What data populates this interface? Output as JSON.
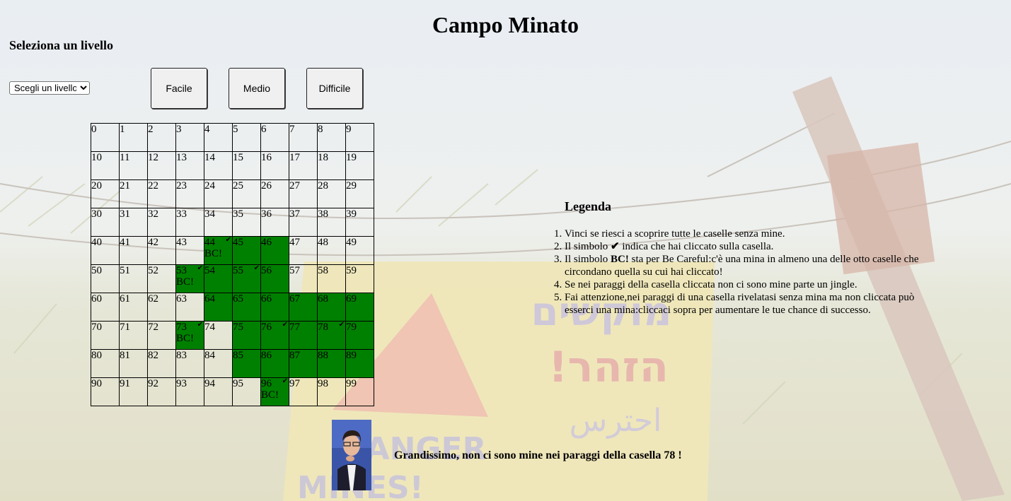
{
  "title": "Campo Minato",
  "level_section": {
    "title": "Seleziona un livello",
    "select_value": "Scegli un livello",
    "buttons": [
      "Facile",
      "Medio",
      "Difficile"
    ]
  },
  "grid": {
    "rows": 10,
    "cols": 10,
    "cells": [
      {
        "n": "0"
      },
      {
        "n": "1"
      },
      {
        "n": "2"
      },
      {
        "n": "3"
      },
      {
        "n": "4"
      },
      {
        "n": "5"
      },
      {
        "n": "6"
      },
      {
        "n": "7"
      },
      {
        "n": "8"
      },
      {
        "n": "9"
      },
      {
        "n": "10"
      },
      {
        "n": "11"
      },
      {
        "n": "12"
      },
      {
        "n": "13"
      },
      {
        "n": "14"
      },
      {
        "n": "15"
      },
      {
        "n": "16"
      },
      {
        "n": "17"
      },
      {
        "n": "18"
      },
      {
        "n": "19"
      },
      {
        "n": "20"
      },
      {
        "n": "21"
      },
      {
        "n": "22"
      },
      {
        "n": "23"
      },
      {
        "n": "24"
      },
      {
        "n": "25"
      },
      {
        "n": "26"
      },
      {
        "n": "27"
      },
      {
        "n": "28"
      },
      {
        "n": "29"
      },
      {
        "n": "30"
      },
      {
        "n": "31"
      },
      {
        "n": "32"
      },
      {
        "n": "33"
      },
      {
        "n": "34"
      },
      {
        "n": "35"
      },
      {
        "n": "36"
      },
      {
        "n": "37"
      },
      {
        "n": "38"
      },
      {
        "n": "39"
      },
      {
        "n": "40"
      },
      {
        "n": "41"
      },
      {
        "n": "42"
      },
      {
        "n": "43"
      },
      {
        "n": "44",
        "state": "revealed",
        "bc": true,
        "checked": true
      },
      {
        "n": "45",
        "state": "revealed"
      },
      {
        "n": "46",
        "state": "revealed"
      },
      {
        "n": "47"
      },
      {
        "n": "48"
      },
      {
        "n": "49"
      },
      {
        "n": "50"
      },
      {
        "n": "51"
      },
      {
        "n": "52"
      },
      {
        "n": "53",
        "state": "revealed",
        "bc": true,
        "checked": true
      },
      {
        "n": "54",
        "state": "revealed"
      },
      {
        "n": "55",
        "state": "revealed",
        "checked": true
      },
      {
        "n": "56",
        "state": "revealed"
      },
      {
        "n": "57"
      },
      {
        "n": "58"
      },
      {
        "n": "59"
      },
      {
        "n": "60"
      },
      {
        "n": "61"
      },
      {
        "n": "62"
      },
      {
        "n": "63"
      },
      {
        "n": "64",
        "state": "revealed"
      },
      {
        "n": "65",
        "state": "revealed"
      },
      {
        "n": "66",
        "state": "revealed"
      },
      {
        "n": "67",
        "state": "revealed"
      },
      {
        "n": "68",
        "state": "revealed"
      },
      {
        "n": "69",
        "state": "revealed"
      },
      {
        "n": "70"
      },
      {
        "n": "71"
      },
      {
        "n": "72"
      },
      {
        "n": "73",
        "state": "revealed",
        "bc": true,
        "checked": true
      },
      {
        "n": "74"
      },
      {
        "n": "75",
        "state": "revealed"
      },
      {
        "n": "76",
        "state": "revealed",
        "checked": true
      },
      {
        "n": "77",
        "state": "revealed"
      },
      {
        "n": "78",
        "state": "revealed",
        "checked": true
      },
      {
        "n": "79",
        "state": "revealed"
      },
      {
        "n": "80"
      },
      {
        "n": "81"
      },
      {
        "n": "82"
      },
      {
        "n": "83"
      },
      {
        "n": "84"
      },
      {
        "n": "85",
        "state": "revealed"
      },
      {
        "n": "86",
        "state": "revealed"
      },
      {
        "n": "87",
        "state": "revealed"
      },
      {
        "n": "88",
        "state": "revealed"
      },
      {
        "n": "89",
        "state": "revealed"
      },
      {
        "n": "90"
      },
      {
        "n": "91"
      },
      {
        "n": "92"
      },
      {
        "n": "93"
      },
      {
        "n": "94"
      },
      {
        "n": "95"
      },
      {
        "n": "96",
        "state": "revealed",
        "bc": true,
        "checked": true
      },
      {
        "n": "97"
      },
      {
        "n": "98"
      },
      {
        "n": "99"
      }
    ],
    "bc_label": "BC!",
    "check_symbol": "✔",
    "revealed_color": "#008000"
  },
  "legend": {
    "title": "Legenda",
    "items": [
      {
        "text": "Vinci se riesci a scoprire tutte le caselle senza mine."
      },
      {
        "pre": "Il simbolo ",
        "bold": "✔",
        "post": " indica che hai cliccato sulla casella."
      },
      {
        "pre": "Il simbolo ",
        "bold": "BC!",
        "post": " sta per Be Careful:c'è una mina in almeno una delle otto caselle che circondano quella su cui hai cliccato!"
      },
      {
        "text": "Se nei paraggi della casella cliccata non ci sono mine parte un jingle."
      },
      {
        "text": "Fai attenzione,nei paraggi di una casella rivelatasi senza mina ma non cliccata può esserci una mina:cliccaci sopra per aumentare le tue chance di successo."
      }
    ]
  },
  "message": "Grandissimo, non ci sono mine nei paraggi della casella 78 !",
  "background_sign": {
    "line1": "מוקשים",
    "line2": "!הזהר",
    "line3": "احترس",
    "line4": "DANGER",
    "line5": "MINES!"
  }
}
